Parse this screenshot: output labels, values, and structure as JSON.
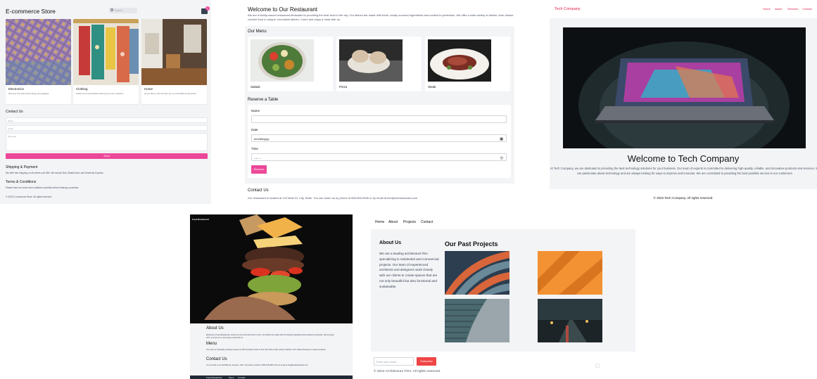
{
  "ecommerce": {
    "title": "E-commerce Store",
    "search_placeholder": "Search...",
    "cart_count": "2",
    "cards": [
      {
        "title": "Electronics",
        "desc": "Discover the latest technology and gadgets."
      },
      {
        "title": "Clothing",
        "desc": "Stylish and comfortable clothing for every occasion."
      },
      {
        "title": "Home",
        "desc": "Home decor and furniture for a comfortable living space."
      }
    ],
    "contact_heading": "Contact Us",
    "name_placeholder": "Name",
    "email_placeholder": "Email",
    "message_placeholder": "Message",
    "send_label": "Send",
    "shipping_heading": "Shipping & Payment",
    "shipping_text": "We offer free shipping on all orders over $50. We accept Visa, MasterCard, and American Express.",
    "terms_heading": "Terms & Conditions",
    "terms_text": "Please read our terms and conditions carefully before making a purchase.",
    "copyright": "© 2022 E-commerce Store. All rights reserved."
  },
  "restaurant": {
    "title": "Welcome to Our Restaurant",
    "intro": "We are a family-owned restaurant dedicated to providing the best food in the city. Our dishes are made with fresh, locally sourced ingredients and cooked to perfection. We offer a wide variety of dishes, from classic comfort food to unique, innovative dishes. Come and enjoy a meal with us.",
    "menu_heading": "Our Menu",
    "menu_items": [
      "Salads",
      "Pizza",
      "Steak"
    ],
    "reserve_heading": "Reserve a Table",
    "name_label": "Name",
    "date_label": "Date",
    "date_value": "mm/dd/yyyy",
    "time_label": "Time",
    "time_value": "--:-- --",
    "reserve_button": "Reserve",
    "contact_heading": "Contact Us",
    "contact_text": "Our restaurant is located at 123 Main St, City, State. You can reach us by phone at 555-555-5555 or by email at info@ourrestaurant.com."
  },
  "tech": {
    "brand": "Tech Company",
    "nav": [
      "Home",
      "About",
      "Services",
      "Contact"
    ],
    "heading": "Welcome to Tech Company",
    "text": "At Tech Company, we are dedicated to providing the best technology solutions for your business. Our team of experts is committed to delivering high-quality, reliable, and innovative products and services. We are passionate about technology and are always looking for ways to improve and innovate. We are committed to providing the best possible service to our customers.",
    "footer": "© 2022 Tech Company. All rights reserved."
  },
  "food": {
    "brand": "Food Restaurant",
    "about_heading": "About Us",
    "about_text": "Welcome to Food Restaurant, where we serve the best food in town. Our dishes are made with the freshest ingredients and cooked to perfection. We are open 24/7, so come on in and enjoy a meal with us.",
    "menu_heading": "Menu",
    "menu_text": "Our menu is constantly evolving to keep up with the latest trends in food. We offer a wide variety of dishes, from classic favorites to unique creations.",
    "contact_heading": "Contact Us",
    "contact_text": "You can find us at 123 Main St, Anytown, USA. Our phone number is 555-123-4567 and our email is info@foodrestaurant.com.",
    "footer_nav": [
      "Food Restaurant",
      "Menu",
      "Contact"
    ]
  },
  "architecture": {
    "nav": [
      "Home",
      "About",
      "Projects",
      "Contact"
    ],
    "about_heading": "About Us",
    "about_text": "We are a leading architecture firm specializing in residential and commercial projects. Our team of experienced architects and designers work closely with our clients to create spaces that are not only beautiful but also functional and sustainable.",
    "projects_heading": "Our Past Projects",
    "email_placeholder": "Enter your email",
    "subscribe_label": "Subscribe",
    "copyright": "© 2022 Architecture Firm. All rights reserved."
  },
  "colors": {
    "pink": "#ec4899",
    "red": "#ef4444",
    "tech_red": "#e11d48"
  }
}
